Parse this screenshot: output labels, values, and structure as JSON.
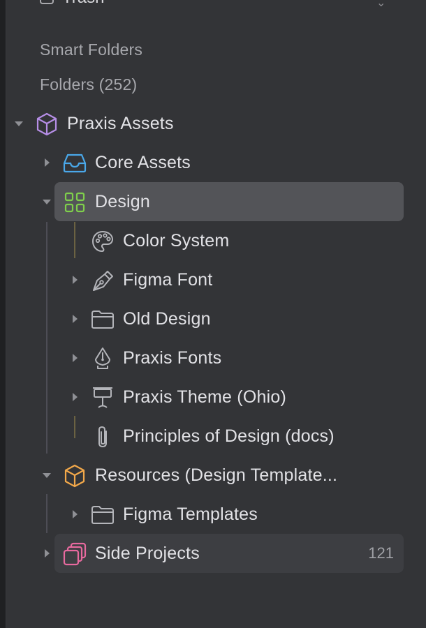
{
  "sidebar": {
    "trash_label": "Trash",
    "smart_folders_label": "Smart Folders",
    "folders_label": "Folders (252)",
    "tree": {
      "praxis_assets": "Praxis Assets",
      "core_assets": "Core Assets",
      "design": "Design",
      "color_system": "Color System",
      "figma_font": "Figma Font",
      "old_design": "Old Design",
      "praxis_fonts": "Praxis Fonts",
      "praxis_theme": "Praxis Theme (Ohio)",
      "principles": "Principles of Design (docs)",
      "resources": "Resources (Design Template...",
      "figma_templates": "Figma Templates",
      "side_projects": "Side Projects",
      "side_projects_count": "121"
    }
  },
  "colors": {
    "background": "#333437",
    "selected_row": "#535458",
    "text": "#e2e2e6",
    "muted_text": "#a7a8ad",
    "praxis_icon": "#b68ee6",
    "core_icon": "#4aa8ea",
    "design_icon": "#7fcf4c",
    "resources_icon": "#f2a84a",
    "side_projects_icon": "#e86a9f"
  }
}
